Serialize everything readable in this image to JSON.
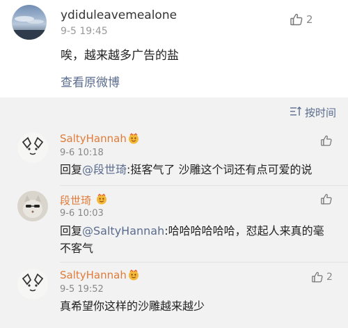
{
  "post": {
    "username": "ydiduleavemealone",
    "timestamp": "9-5 19:45",
    "text": "唉，越来越多广告的盐",
    "view_original": "查看原微博",
    "like_count": "2"
  },
  "replies_header": {
    "sort_label": "按时间"
  },
  "replies": [
    {
      "username": "SaltyHannah",
      "timestamp": "9-6 10:18",
      "prefix": "回复",
      "mention": "@段世琦",
      "text": ":挺客气了 沙雕这个词还有点可爱的说",
      "like_count": ""
    },
    {
      "username": "段世琦",
      "timestamp": "9-6 10:03",
      "prefix": "回复",
      "mention": "@SaltyHannah",
      "text": ":哈哈哈哈哈哈，怼起人来真的毫不客气",
      "like_count": ""
    },
    {
      "username": "SaltyHannah",
      "timestamp": "9-5 19:52",
      "prefix": "",
      "mention": "",
      "text": "真希望你这样的沙雕越来越少",
      "like_count": "2"
    }
  ],
  "colors": {
    "link": "#5a6c8e",
    "username_orange": "#e07b39",
    "reply_bg": "#f2f2f2"
  },
  "icons": {
    "like": "thumbs-up-icon",
    "sort": "sort-icon",
    "badge": "vip-badge-icon"
  }
}
